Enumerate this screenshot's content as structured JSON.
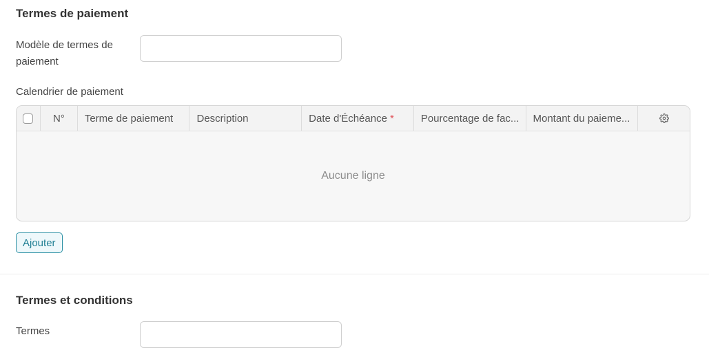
{
  "payment_section": {
    "title": "Termes de paiement",
    "template_label": "Modèle de termes de paiement",
    "template_value": "",
    "schedule_label": "Calendrier de paiement"
  },
  "schedule_table": {
    "columns": {
      "index": "N°",
      "payment_term": "Terme de paiement",
      "description": "Description",
      "due_date": "Date d'Échéance",
      "invoice_portion": "Pourcentage de fac...",
      "payment_amount": "Montant du paieme..."
    },
    "required_marker": "*",
    "empty_text": "Aucune ligne",
    "add_label": "Ajouter"
  },
  "terms_section": {
    "title": "Termes et conditions",
    "terms_label": "Termes",
    "terms_value": ""
  },
  "icons": {
    "settings": "gear-icon"
  },
  "colors": {
    "accent": "#1f7e93",
    "required": "#e0535a"
  }
}
